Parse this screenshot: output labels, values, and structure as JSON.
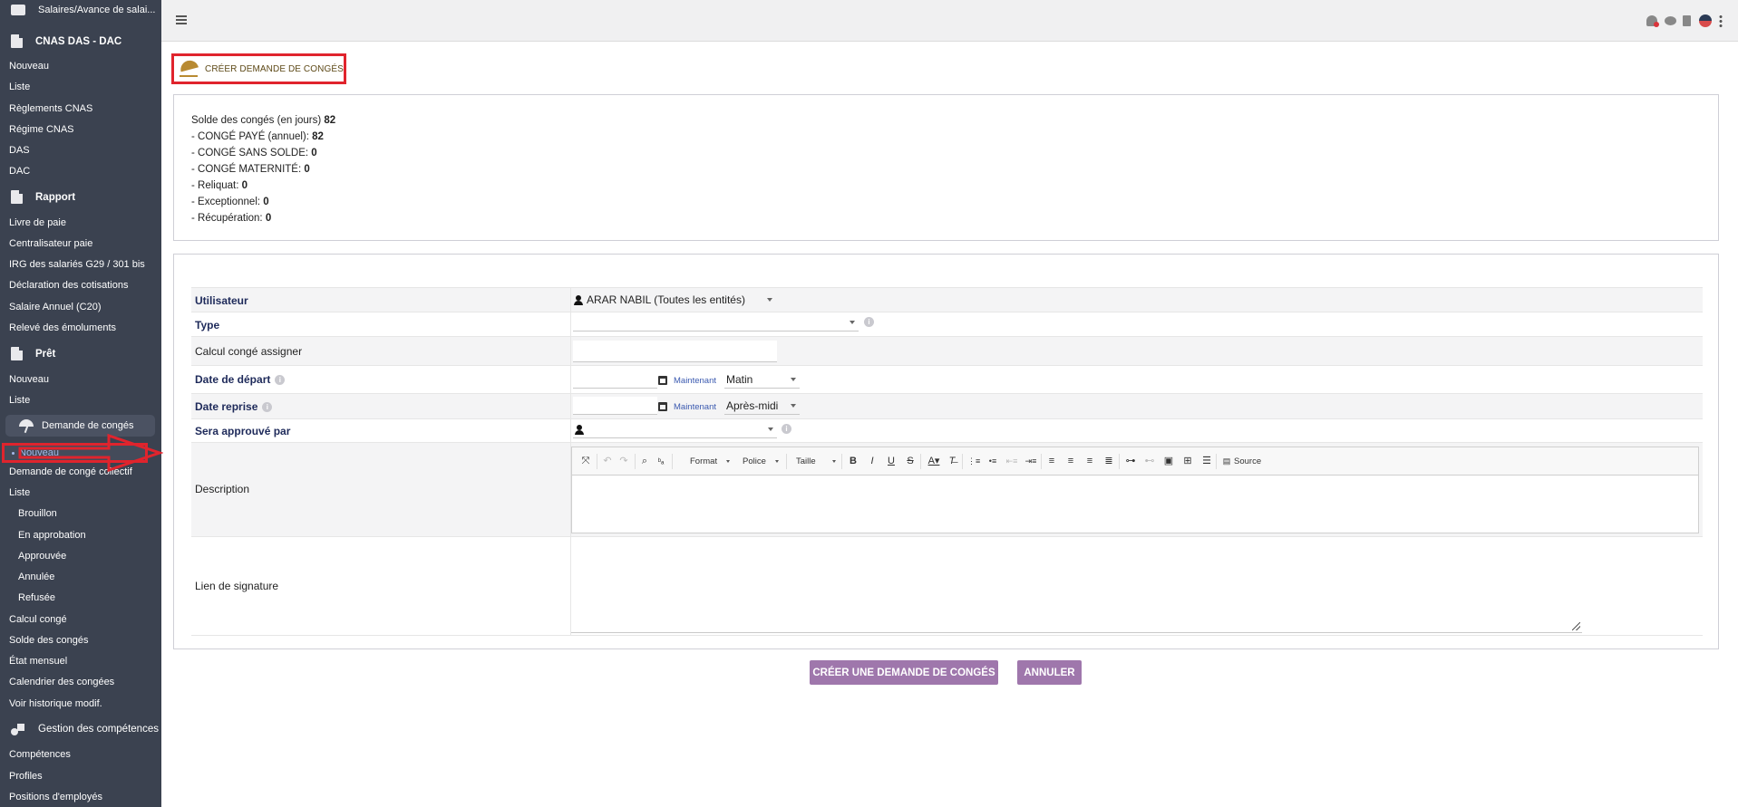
{
  "sidebar": {
    "top_item": "Salaires/Avance de salai...",
    "sections": [
      {
        "title": "CNAS DAS - DAC",
        "items": [
          "Nouveau",
          "Liste",
          "Règlements CNAS",
          "Régime CNAS",
          "DAS",
          "DAC"
        ]
      },
      {
        "title": "Rapport",
        "items": [
          "Livre de paie",
          "Centralisateur paie",
          "IRG des salariés G29 / 301 bis",
          "Déclaration des cotisations",
          "Salaire Annuel (C20)",
          "Relevé des émoluments"
        ]
      },
      {
        "title": "Prêt",
        "items": [
          "Nouveau",
          "Liste"
        ]
      }
    ],
    "active_group": "Demande de congés",
    "active_item": "Nouveau",
    "conges_items": [
      "Demande de congé collectif",
      "Liste"
    ],
    "liste_sub": [
      "Brouillon",
      "En approbation",
      "Approuvée",
      "Annulée",
      "Refusée"
    ],
    "conges_more": [
      "Calcul congé",
      "Solde des congés",
      "État mensuel",
      "Calendrier des congées",
      "Voir historique modif."
    ],
    "competences_title": "Gestion des compétences",
    "competences_items": [
      "Compétences",
      "Profiles",
      "Positions d'employés"
    ]
  },
  "page": {
    "title": "CRÉER DEMANDE DE CONGÉS"
  },
  "balance": {
    "lines": [
      {
        "label": "Solde des congés (en jours)",
        "value": "82"
      },
      {
        "label": "- CONGÉ PAYÉ (annuel):",
        "value": "82"
      },
      {
        "label": "- CONGÉ SANS SOLDE:",
        "value": "0"
      },
      {
        "label": "- CONGÉ MATERNITÉ:",
        "value": "0"
      },
      {
        "label": "- Reliquat:",
        "value": "0"
      },
      {
        "label": "- Exceptionnel:",
        "value": "0"
      },
      {
        "label": "- Récupération:",
        "value": "0"
      }
    ]
  },
  "form": {
    "utilisateur_label": "Utilisateur",
    "utilisateur_value": "ARAR NABIL (Toutes les entités)",
    "type_label": "Type",
    "type_value": "",
    "calcul_label": "Calcul congé assigner",
    "calcul_value": "",
    "depart_label": "Date de départ",
    "depart_value": "",
    "depart_now": "Maintenant",
    "depart_period": "Matin",
    "reprise_label": "Date reprise",
    "reprise_value": "",
    "reprise_now": "Maintenant",
    "reprise_period": "Après-midi",
    "approver_label": "Sera approuvé par",
    "approver_value": "",
    "description_label": "Description",
    "signature_label": "Lien de signature",
    "editor": {
      "format": "Format",
      "police": "Police",
      "taille": "Taille",
      "source": "Source"
    }
  },
  "buttons": {
    "create": "CRÉER UNE DEMANDE DE CONGÉS",
    "cancel": "ANNULER"
  },
  "colors": {
    "sidebar_bg": "#3b4250",
    "button_bg": "#9f77ac",
    "highlight_red": "#e0242d",
    "label_navy": "#1e2a5a"
  }
}
